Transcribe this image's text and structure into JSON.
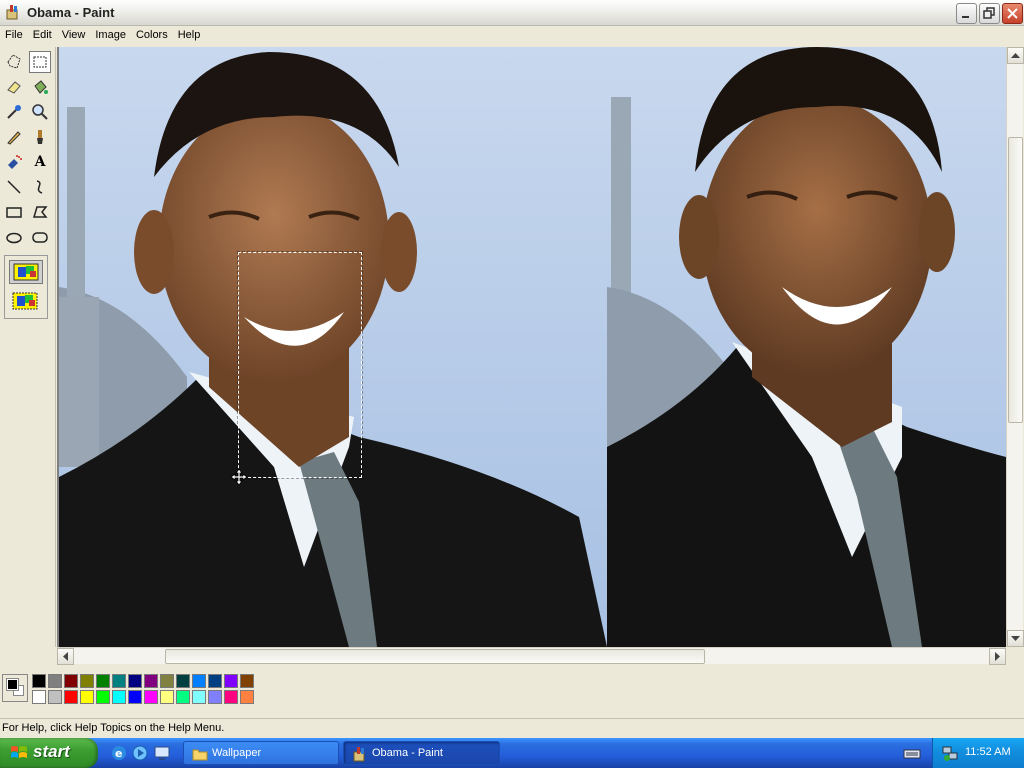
{
  "window": {
    "title": "Obama - Paint"
  },
  "menu": [
    "File",
    "Edit",
    "View",
    "Image",
    "Colors",
    "Help"
  ],
  "tools": [
    {
      "name": "free-form-select-icon"
    },
    {
      "name": "rect-select-icon"
    },
    {
      "name": "eraser-icon"
    },
    {
      "name": "fill-icon"
    },
    {
      "name": "pick-color-icon"
    },
    {
      "name": "magnifier-icon"
    },
    {
      "name": "pencil-icon"
    },
    {
      "name": "brush-icon"
    },
    {
      "name": "airbrush-icon"
    },
    {
      "name": "text-icon"
    },
    {
      "name": "line-icon"
    },
    {
      "name": "curve-icon"
    },
    {
      "name": "rectangle-icon"
    },
    {
      "name": "polygon-icon"
    },
    {
      "name": "ellipse-icon"
    },
    {
      "name": "rounded-rect-icon"
    }
  ],
  "text_tool_glyph": "A",
  "palette": {
    "foreground": "#000000",
    "background": "#ffffff",
    "top_row": [
      "#000000",
      "#808080",
      "#800000",
      "#808000",
      "#008000",
      "#008080",
      "#000080",
      "#800080",
      "#808040",
      "#004040",
      "#0080ff",
      "#004080",
      "#8000ff",
      "#804000"
    ],
    "bottom_row": [
      "#ffffff",
      "#c0c0c0",
      "#ff0000",
      "#ffff00",
      "#00ff00",
      "#00ffff",
      "#0000ff",
      "#ff00ff",
      "#ffff80",
      "#00ff80",
      "#80ffff",
      "#8080ff",
      "#ff0080",
      "#ff8040"
    ]
  },
  "status": {
    "help_text": "For Help, click Help Topics on the Help Menu."
  },
  "taskbar": {
    "start_label": "start",
    "tasks": [
      {
        "label": "Wallpaper",
        "icon": "folder-icon"
      },
      {
        "label": "Obama - Paint",
        "icon": "paint-icon"
      }
    ],
    "clock": "11:52 AM"
  }
}
